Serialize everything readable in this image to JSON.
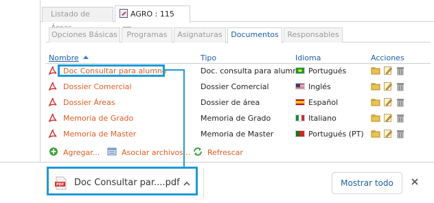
{
  "window_tabs": [
    {
      "label": "Listado de Áreas",
      "active": false
    },
    {
      "label": "AGRO : 115",
      "active": true,
      "close_glyph": "x"
    }
  ],
  "inner_tabs": [
    {
      "label": "Opciones Básicas",
      "active": false
    },
    {
      "label": "Programas",
      "active": false
    },
    {
      "label": "Asignaturas",
      "active": false
    },
    {
      "label": "Documentos",
      "active": true
    },
    {
      "label": "Responsables",
      "active": false
    }
  ],
  "table": {
    "columns": [
      "Nombre",
      "Tipo",
      "Idioma",
      "Acciones"
    ],
    "rows": [
      {
        "nombre": "Doc Consultar para alumno",
        "tipo": "Doc. consulta para alumno",
        "idioma": "Portugués",
        "flag": "br"
      },
      {
        "nombre": "Dossier Comercial",
        "tipo": "Dossier Comercial",
        "idioma": "Inglés",
        "flag": "en"
      },
      {
        "nombre": "Dossier Áreas",
        "tipo": "Dossier de área",
        "idioma": "Español",
        "flag": "es"
      },
      {
        "nombre": "Memoria de Grado",
        "tipo": "Memoria de Grado",
        "idioma": "Italiano",
        "flag": "it"
      },
      {
        "nombre": "Memoria de Master",
        "tipo": "Memoria de Master",
        "idioma": "Portugués (PT)",
        "flag": "pt"
      }
    ],
    "row_action_icons": [
      "folder-icon",
      "pencil-icon",
      "trash-icon"
    ]
  },
  "footer_actions": [
    {
      "label": "Agregar...",
      "icon": "add-icon"
    },
    {
      "label": "Asociar archivos...",
      "icon": "attach-files-icon"
    },
    {
      "label": "Refrescar",
      "icon": "refresh-icon"
    }
  ],
  "download_bar": {
    "file_name": "Doc Consultar par....pdf",
    "file_icon": "pdf-file-icon",
    "show_all_label": "Mostrar todo",
    "close_icon": "close-icon"
  },
  "colors": {
    "link_orange": "#e25c1f",
    "header_blue": "#1a5fa8",
    "highlight_blue": "#1a9ad6"
  }
}
